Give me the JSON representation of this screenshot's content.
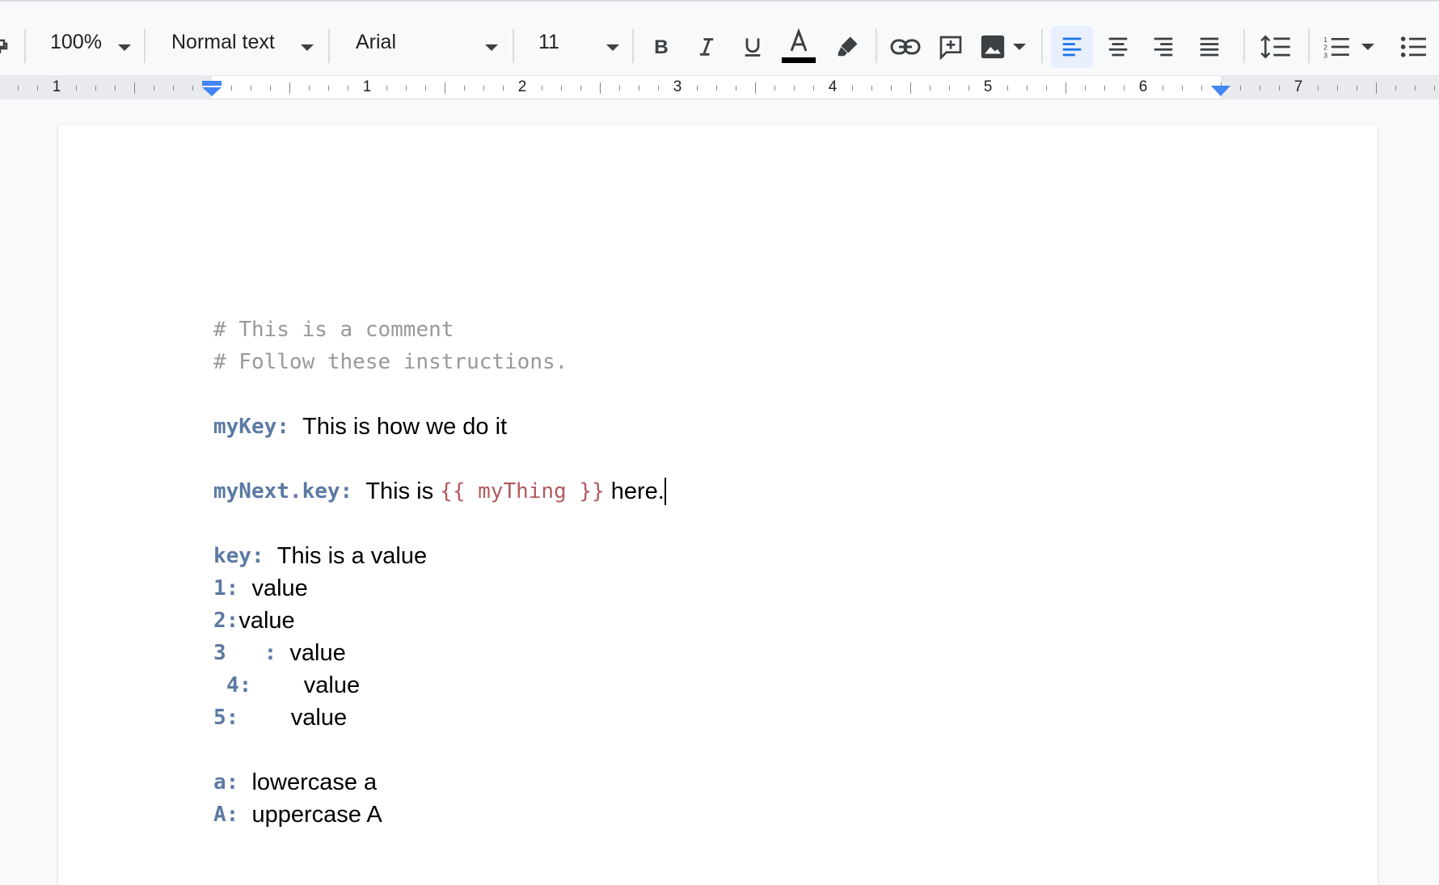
{
  "toolbar": {
    "zoom": "100%",
    "paragraph_style": "Normal text",
    "font_family": "Arial",
    "font_size": "11",
    "text_color": "#000000",
    "accent_color": "#1a73e8",
    "buttons": [
      "paint-format",
      "zoom",
      "paragraph-style",
      "font",
      "font-size",
      "bold",
      "italic",
      "underline",
      "text-color",
      "highlight",
      "link",
      "comment",
      "image",
      "align-left",
      "align-center",
      "align-right",
      "justify",
      "line-spacing",
      "numbered-list",
      "bulleted-list"
    ]
  },
  "ruler": {
    "labels": [
      "1",
      "1",
      "2",
      "3",
      "4",
      "5",
      "6",
      "7"
    ]
  },
  "document": {
    "comment1": "# This is a comment",
    "comment2": "# Follow these instructions.",
    "line1_key": "myKey:",
    "line1_value": "This is how we do it",
    "line2_key": "myNext.key:",
    "line2_value_a": "This is",
    "line2_template": "{{ myThing }}",
    "line2_value_b": "here.",
    "line3_key": "key:",
    "line3_value": "This is a value",
    "list": [
      {
        "key": "1:",
        "value": "value"
      },
      {
        "key": "2:",
        "value": "value"
      },
      {
        "key": "3",
        "key2": ":",
        "value": "value"
      },
      {
        "key": "4:",
        "value": "value"
      },
      {
        "key": "5:",
        "value": "value"
      }
    ],
    "case_a_key": "a:",
    "case_a_value": "lowercase a",
    "case_A_key": "A:",
    "case_A_value": "uppercase A"
  }
}
